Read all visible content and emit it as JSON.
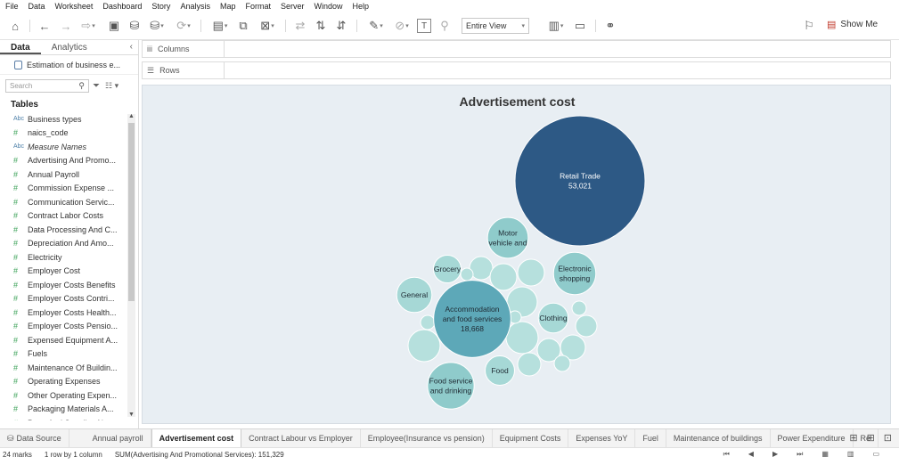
{
  "menu": [
    "File",
    "Data",
    "Worksheet",
    "Dashboard",
    "Story",
    "Analysis",
    "Map",
    "Format",
    "Server",
    "Window",
    "Help"
  ],
  "toolbar": {
    "fit_value": "Entire View",
    "show_me": "Show Me"
  },
  "left_panel": {
    "tab_data": "Data",
    "tab_analytics": "Analytics",
    "collapse": "‹",
    "data_source": "Estimation of business e...",
    "search_placeholder": "Search",
    "tables_header": "Tables",
    "fields": [
      {
        "type": "Abc",
        "name": "Business types"
      },
      {
        "type": "#",
        "name": "naics_code"
      },
      {
        "type": "Abc",
        "name": "Measure Names"
      },
      {
        "type": "#",
        "name": "Advertising And Promo..."
      },
      {
        "type": "#",
        "name": "Annual Payroll"
      },
      {
        "type": "#",
        "name": "Commission Expense ..."
      },
      {
        "type": "#",
        "name": "Communication Servic..."
      },
      {
        "type": "#",
        "name": "Contract Labor Costs"
      },
      {
        "type": "#",
        "name": "Data Processing And C..."
      },
      {
        "type": "#",
        "name": "Depreciation And Amo..."
      },
      {
        "type": "#",
        "name": "Electricity"
      },
      {
        "type": "#",
        "name": "Employer Cost"
      },
      {
        "type": "#",
        "name": "Employer Costs Benefits"
      },
      {
        "type": "#",
        "name": "Employer Costs Contri..."
      },
      {
        "type": "#",
        "name": "Employer Costs Health..."
      },
      {
        "type": "#",
        "name": "Employer Costs Pensio..."
      },
      {
        "type": "#",
        "name": "Expensed Equipment A..."
      },
      {
        "type": "#",
        "name": "Fuels"
      },
      {
        "type": "#",
        "name": "Maintenance Of Buildin..."
      },
      {
        "type": "#",
        "name": "Operating Expenses"
      },
      {
        "type": "#",
        "name": "Other Operating Expen..."
      },
      {
        "type": "#",
        "name": "Packaging Materials A..."
      },
      {
        "type": "#",
        "name": "Parts And Supplies Not..."
      }
    ]
  },
  "shelves": {
    "columns": "Columns",
    "rows": "Rows"
  },
  "colors": {
    "bubble_dark": "#2d5985",
    "bubble_mid": "#5da8b8",
    "bubble_light": "#9dd4d2",
    "bubble_lighter": "#b6e0dd",
    "canvas_bg": "#e8eef3"
  },
  "chart_data": {
    "type": "bubble",
    "title": "Advertisement cost",
    "total_label": "SUM(Advertising And Promotional Services): 151,329",
    "bubbles": [
      {
        "label": "Retail Trade",
        "value": 53021,
        "value_label": "53,021",
        "color": "#2d5985"
      },
      {
        "label": "Accommodation and food services",
        "value": 18668,
        "value_label": "18,668",
        "color": "#5da8b8"
      },
      {
        "label": "Food service and drinking",
        "value": 6800,
        "color": "#8fcbcb"
      },
      {
        "label": "Motor vehicle and",
        "value": 5200,
        "color": "#8fcbcb"
      },
      {
        "label": "Electronic shopping",
        "value": 5600,
        "color": "#8fcbcb"
      },
      {
        "label": "General",
        "value": 3900,
        "color": "#a6d8d6"
      },
      {
        "label": "Clothing",
        "value": 2800,
        "color": "#a6d8d6"
      },
      {
        "label": "Food",
        "value": 2700,
        "color": "#a6d8d6"
      },
      {
        "label": "Grocery",
        "value": 2400,
        "color": "#a6d8d6"
      }
    ],
    "unlabeled_bubble_count": 15
  },
  "sheet_tabs": [
    {
      "label": "Data Source",
      "active": false,
      "ds": true
    },
    {
      "label": "Annual payroll",
      "active": false
    },
    {
      "label": "Advertisement cost",
      "active": true
    },
    {
      "label": "Contract Labour vs Employer",
      "active": false
    },
    {
      "label": "Employee(Insurance vs pension)",
      "active": false
    },
    {
      "label": "Equipment Costs",
      "active": false
    },
    {
      "label": "Expenses YoY",
      "active": false
    },
    {
      "label": "Fuel",
      "active": false
    },
    {
      "label": "Maintenance of buildings",
      "active": false
    },
    {
      "label": "Power Expenditure",
      "active": false
    },
    {
      "label": "Re",
      "active": false
    }
  ],
  "status": {
    "marks": "24 marks",
    "rows_cols": "1 row by 1 column",
    "sum": "SUM(Advertising And Promotional Services): 151,329"
  }
}
